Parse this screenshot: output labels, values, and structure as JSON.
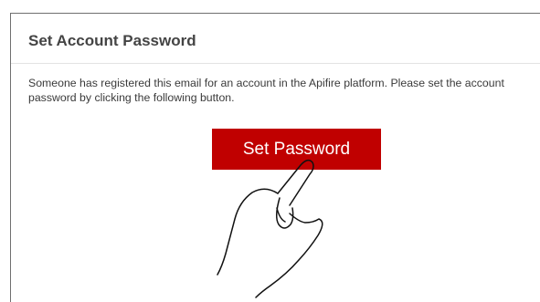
{
  "email": {
    "heading": "Set Account Password",
    "message": "Someone has registered this email for an account in the Apifire platform. Please set the account password by clicking the following button.",
    "button_label": "Set Password",
    "button_color": "#c00000"
  },
  "overlay": {
    "icon": "pointing-hand-icon"
  }
}
